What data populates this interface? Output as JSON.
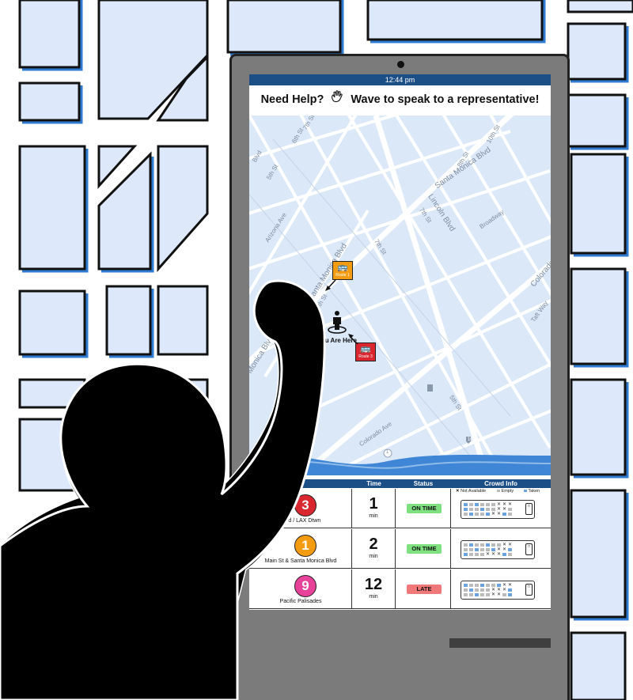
{
  "header": {
    "time": "12:44 pm"
  },
  "help_banner": {
    "need_help": "Need Help?",
    "wave_icon": "waving-hand-icon",
    "message": "Wave to speak to a representative!"
  },
  "map": {
    "you_are_here": "You Are Here",
    "bus_pins": [
      {
        "label": "Route 1",
        "color": "#f39c12"
      },
      {
        "label": "Route 3",
        "color": "#d9262f"
      }
    ],
    "streets": {
      "santa_monica_blvd_top": "Santa Monica Blvd",
      "santa_monica_blvd_mid": "Santa Monica Blvd",
      "monica_blvd": "Monica Blvd",
      "lincoln_blvd": "Lincoln Blvd",
      "broadway": "Broadway",
      "colorado_ave": "Colorado Ave",
      "colorado_right": "Colorado",
      "arizona_ave": "Arizona Ave",
      "taft_way": "Taft Way",
      "s4th": "4th St",
      "s5th_a": "5th St",
      "s5th_b": "5th St",
      "s6th": "6th St",
      "s7th_a": "7th St",
      "s7th_b": "7th St",
      "s7th_c": "7th St",
      "s10th": "10th St",
      "s8th": "8th St",
      "blvd": "Blvd",
      "hwy10": "10",
      "hwy1a": "1",
      "hwy1b": "1"
    }
  },
  "table": {
    "headers": {
      "route": "",
      "time": "Time",
      "status": "Status",
      "crowd": "Crowd Info"
    },
    "legend": {
      "not_available": "Not Available",
      "empty": "Empty",
      "taken": "Taken"
    },
    "rows": [
      {
        "number": "3",
        "color": "#d9262f",
        "name": "Blvd / LAX Dtwn",
        "time": "1",
        "unit": "min",
        "status": "ON TIME",
        "status_color": "#7ee07e"
      },
      {
        "number": "1",
        "color": "#f39c12",
        "name": "Main St & Santa Monica Blvd",
        "time": "2",
        "unit": "min",
        "status": "ON TIME",
        "status_color": "#7ee07e"
      },
      {
        "number": "9",
        "color": "#e8419a",
        "name": "Pacific Palisades",
        "time": "12",
        "unit": "min",
        "status": "LATE",
        "status_color": "#f07878"
      }
    ]
  },
  "colors": {
    "header_blue": "#1c4f86",
    "map_bg": "#dbe8f8",
    "block_fill": "#dde9fb",
    "block_shadow": "#2f7bd1",
    "kiosk_gray": "#7b7b7b",
    "water": "#3f86d6"
  }
}
